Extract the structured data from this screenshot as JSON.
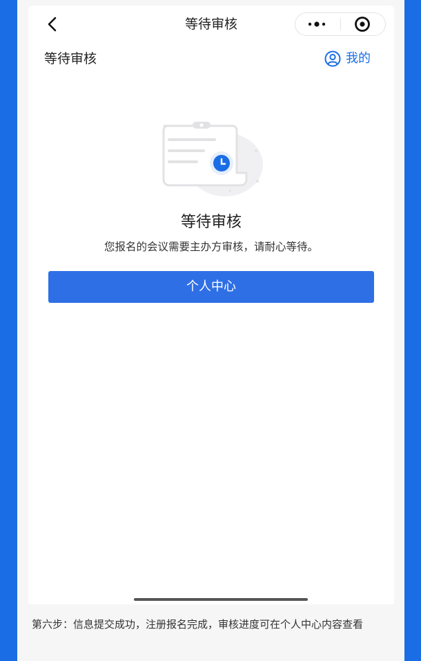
{
  "nav": {
    "title": "等待审核",
    "back_icon": "chevron-left-icon",
    "more_icon": "more-dots-icon",
    "close_icon": "target-close-icon"
  },
  "header": {
    "title": "等待审核",
    "mine_label": "我的",
    "mine_icon": "user-circle-icon"
  },
  "status": {
    "icon": "pending-document-clock-icon",
    "title": "等待审核",
    "description": "您报名的会议需要主办方审核，请耐心等待。"
  },
  "actions": {
    "primary_label": "个人中心"
  },
  "caption": "第六步：信息提交成功，注册报名完成，审核进度可在个人中心内容查看",
  "colors": {
    "frame_background": "#1a6de4",
    "accent": "#1a6de4",
    "primary_button": "#2f6fe6"
  }
}
